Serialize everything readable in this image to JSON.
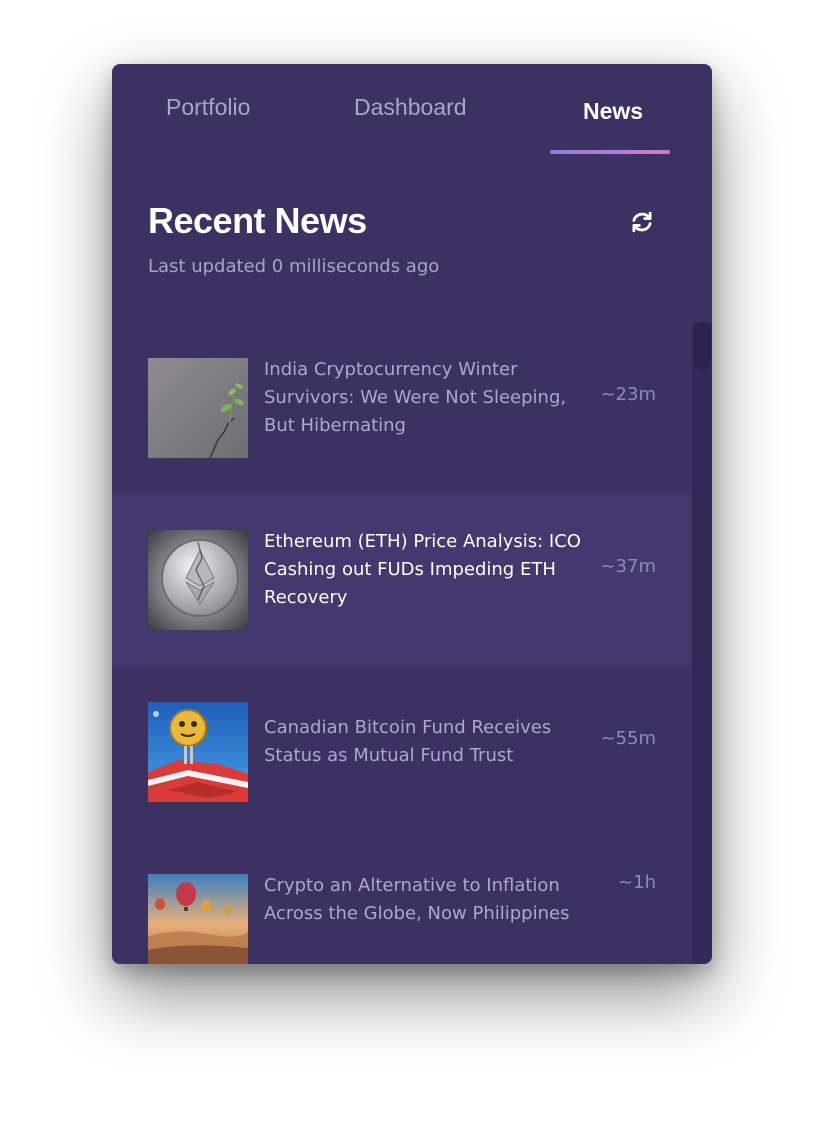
{
  "tabs": [
    {
      "label": "Portfolio",
      "active": false
    },
    {
      "label": "Dashboard",
      "active": false
    },
    {
      "label": "News",
      "active": true
    }
  ],
  "header": {
    "title": "Recent News",
    "subtitle": "Last updated 0 milliseconds ago",
    "refresh_icon": "refresh-icon"
  },
  "news": [
    {
      "title": "India Cryptocurrency Winter Survivors: We Were Not Sleeping, But Hibernating",
      "age": "~23m",
      "thumb": "sprout-in-crack"
    },
    {
      "title": "Ethereum (ETH) Price Analysis: ICO Cashing out FUDs Impeding ETH Recovery",
      "age": "~37m",
      "thumb": "cracked-ether-coin"
    },
    {
      "title": "Canadian Bitcoin Fund Receives Status as Mutual Fund Trust",
      "age": "~55m",
      "thumb": "coin-on-canada-map"
    },
    {
      "title": "Crypto an Alternative to Inflation Across the Globe, Now Philippines",
      "age": "~1h",
      "thumb": "hot-air-balloons"
    }
  ],
  "colors": {
    "background": "#3b3262",
    "highlight_row": "#44396e",
    "accent_start": "#8b7fe0",
    "accent_end": "#d37ac4",
    "muted_text": "#a6a4c9"
  }
}
